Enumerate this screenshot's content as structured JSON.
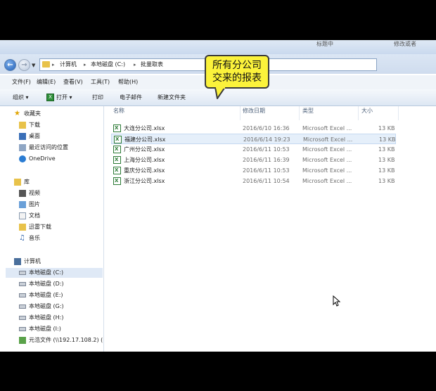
{
  "window": {
    "background_text": [
      "帮助",
      "标题中",
      "修改或者"
    ]
  },
  "address_bar": {
    "breadcrumbs": [
      "计算机",
      "本地磁盘 (C:)",
      "批量取表"
    ]
  },
  "menu": {
    "items": [
      "文件(F)",
      "编辑(E)",
      "查看(V)",
      "工具(T)",
      "帮助(H)"
    ]
  },
  "toolbar": {
    "organize": "组织",
    "open": "打开",
    "print": "打印",
    "email": "电子邮件",
    "new_folder": "新建文件夹"
  },
  "navigation": {
    "favorites_header": "收藏夹",
    "favorites": [
      "下载",
      "桌面",
      "最近访问的位置",
      "OneDrive"
    ],
    "library_header": "库",
    "libraries": [
      "视频",
      "图片",
      "文档",
      "迅雷下载",
      "音乐"
    ],
    "computer_header": "计算机",
    "drives": [
      "本地磁盘 (C:)",
      "本地磁盘 (D:)",
      "本地磁盘 (E:)",
      "本地磁盘 (G:)",
      "本地磁盘 (H:)",
      "本地磁盘 (I:)",
      "元浩文件 (\\\\192.17.108.2) ("
    ]
  },
  "file_list": {
    "columns": {
      "name": "名称",
      "date": "修改日期",
      "type": "类型",
      "size": "大小"
    },
    "files": [
      {
        "name": "大连分公司.xlsx",
        "date": "2016/6/10 16:36",
        "type": "Microsoft Excel ...",
        "size": "13 KB"
      },
      {
        "name": "福建分公司.xlsx",
        "date": "2016/6/14 19:23",
        "type": "Microsoft Excel ...",
        "size": "13 KB"
      },
      {
        "name": "广州分公司.xlsx",
        "date": "2016/6/11 10:53",
        "type": "Microsoft Excel ...",
        "size": "13 KB"
      },
      {
        "name": "上海分公司.xlsx",
        "date": "2016/6/11 16:39",
        "type": "Microsoft Excel ...",
        "size": "13 KB"
      },
      {
        "name": "重庆分公司.xlsx",
        "date": "2016/6/11 10:53",
        "type": "Microsoft Excel ...",
        "size": "13 KB"
      },
      {
        "name": "浙江分公司.xlsx",
        "date": "2016/6/11 10:54",
        "type": "Microsoft Excel ...",
        "size": "13 KB"
      }
    ]
  },
  "callout": {
    "line1": "所有分公司",
    "line2": "交来的报表"
  },
  "colors": {
    "callout_fill": "#fbf23b",
    "selection": "#e5effa",
    "excel_green": "#2c7a36"
  }
}
